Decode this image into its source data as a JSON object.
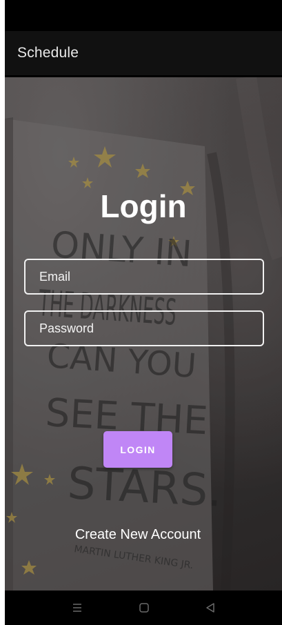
{
  "app_bar": {
    "title": "Schedule"
  },
  "login": {
    "title": "Login",
    "email_placeholder": "Email",
    "password_placeholder": "Password",
    "button_label": "LOGIN",
    "create_account_label": "Create New Account"
  },
  "background": {
    "quote_lines": [
      "ONLY IN",
      "THE DARKNESS",
      "CAN YOU",
      "SEE THE",
      "STARS."
    ],
    "quote_author": "MARTIN LUTHER KING JR."
  },
  "colors": {
    "accent": "#c086f6",
    "app_bar": "#111111",
    "text": "#ffffff"
  },
  "nav_icons": [
    "menu-icon",
    "home-icon",
    "back-icon"
  ]
}
